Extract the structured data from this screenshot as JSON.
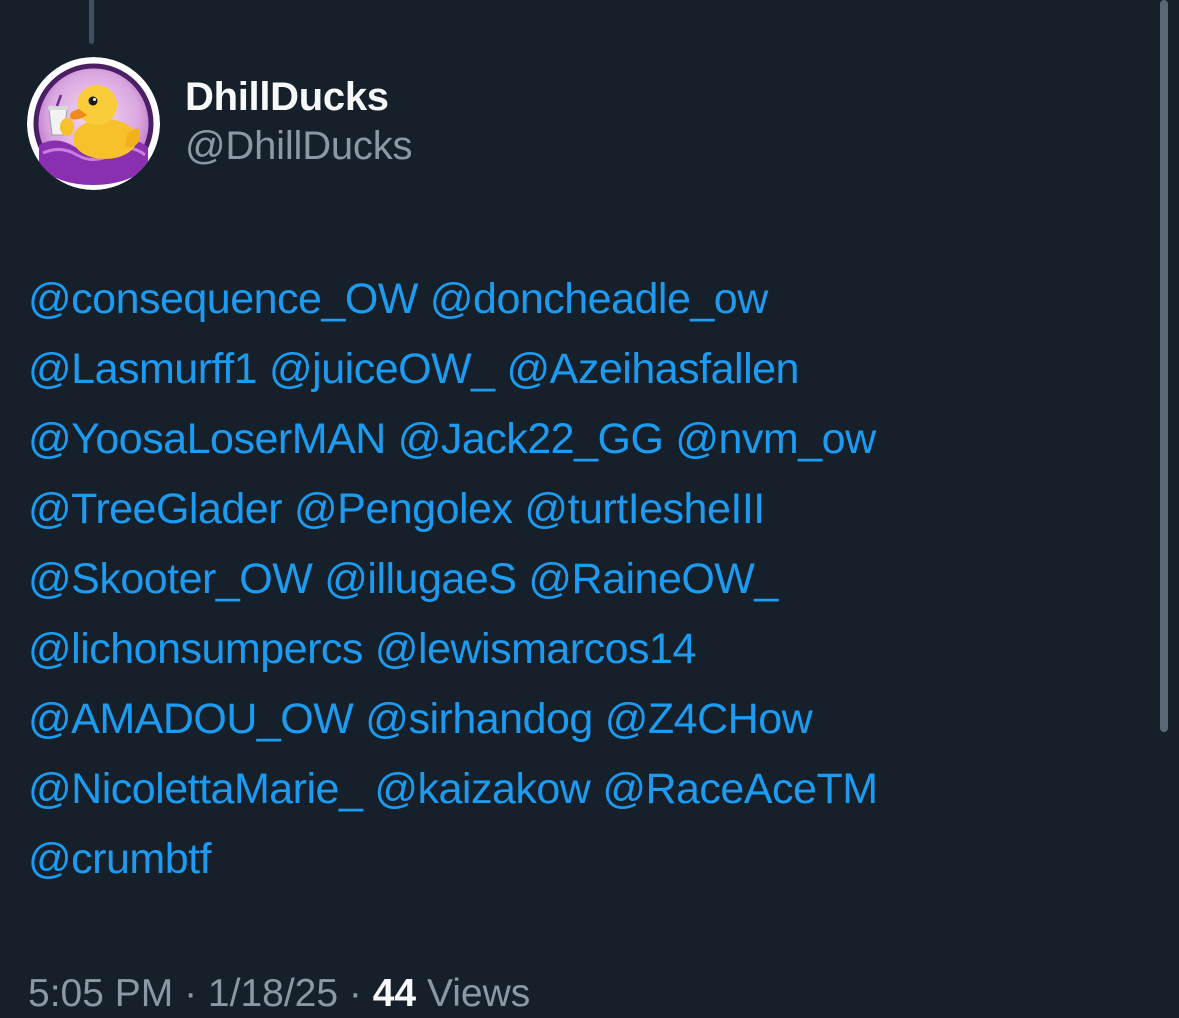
{
  "author": {
    "display_name": "DhillDucks",
    "handle": "@DhillDucks"
  },
  "tweet": {
    "lines": [
      [
        "@consequence_OW",
        "@doncheadle_ow"
      ],
      [
        "@Lasmurff1",
        "@juiceOW_",
        "@Azeihasfallen"
      ],
      [
        "@YoosaLoserMAN",
        "@Jack22_GG",
        "@nvm_ow"
      ],
      [
        "@TreeGlader",
        "@Pengolex",
        "@turtIesheIII"
      ],
      [
        "@Skooter_OW",
        "@illugaeS",
        "@RaineOW_"
      ],
      [
        "@lichonsumpercs",
        "@lewismarcos14"
      ],
      [
        "@AMADOU_OW",
        "@sirhandog",
        "@Z4CHow"
      ],
      [
        "@NicolettaMarie_",
        "@kaizakow",
        "@RaceAceTM"
      ],
      [
        "@crumbtf"
      ]
    ]
  },
  "meta": {
    "time": "5:05 PM",
    "separator": " · ",
    "date": "1/18/25",
    "views_count": "44",
    "views_label": "Views"
  },
  "colors": {
    "background": "#15202b",
    "mention": "#1d9bf0",
    "primary_text": "#f7f9f9",
    "secondary_text": "#8b98a5"
  },
  "icons": {
    "avatar": "rubber-duck-avatar"
  }
}
